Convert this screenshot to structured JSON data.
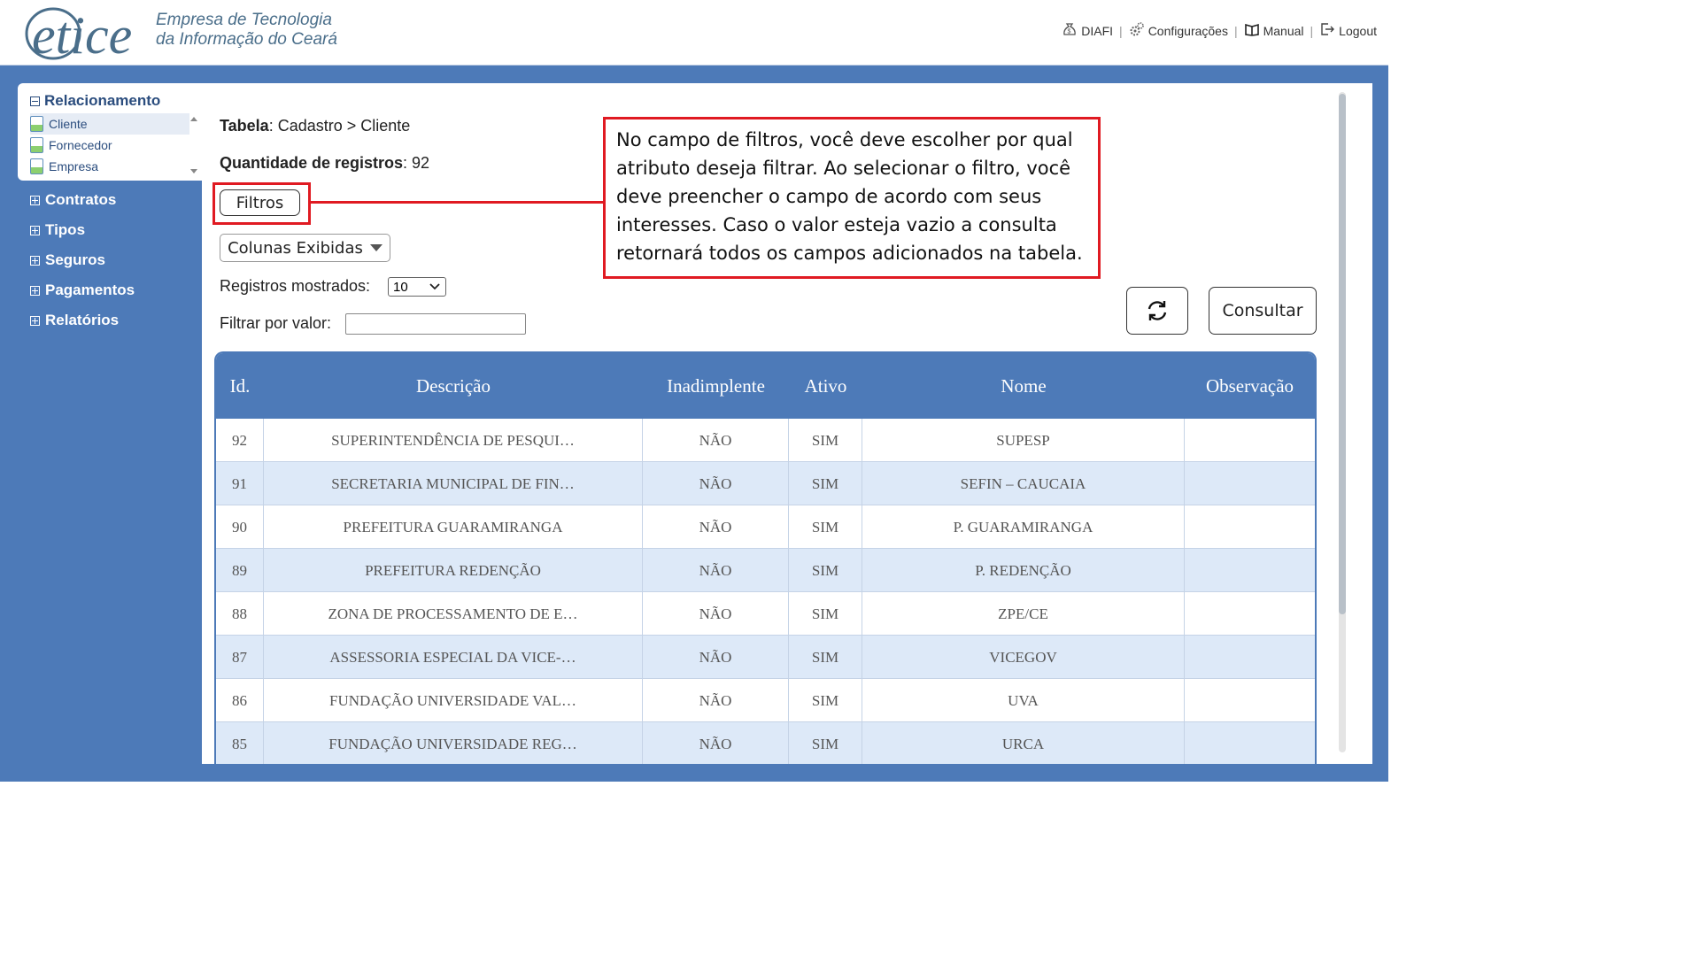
{
  "header": {
    "logo_name": "etice",
    "logo_line1": "Empresa de Tecnologia",
    "logo_line2": "da Informação do Ceará",
    "links": {
      "diafi": "DIAFI",
      "config": "Configurações",
      "manual": "Manual",
      "logout": "Logout",
      "separator": "|"
    }
  },
  "sidebar": {
    "open_group": {
      "title": "Relacionamento",
      "items": [
        "Cliente",
        "Fornecedor",
        "Empresa"
      ],
      "selected": "Cliente"
    },
    "groups": [
      "Contratos",
      "Tipos",
      "Seguros",
      "Pagamentos",
      "Relatórios"
    ]
  },
  "content": {
    "tabela_label": "Tabela",
    "tabela_value": ": Cadastro > Cliente",
    "qtd_label": "Quantidade de registros",
    "qtd_value": ": 92",
    "filtros_button": "Filtros",
    "colunas_button": "Colunas Exibidas",
    "registros_label": "Registros mostrados:",
    "registros_value": "10",
    "filtrar_label": "Filtrar por valor:",
    "filtrar_value": "",
    "consultar_button": "Consultar",
    "refresh_icon": "refresh-icon"
  },
  "callout": {
    "text": "No campo de filtros, você deve escolher por qual atributo deseja filtrar. Ao selecionar o filtro, você deve preencher o campo de acordo com seus interesses. Caso o valor esteja vazio a consulta retornará todos os campos adicionados na tabela.",
    "color": "#e01a22"
  },
  "table": {
    "headers": [
      "Id.",
      "Descrição",
      "Inadimplente",
      "Ativo",
      "Nome",
      "Observação"
    ],
    "rows": [
      [
        "92",
        "SUPERINTENDÊNCIA DE PESQUI…",
        "NÃO",
        "SIM",
        "SUPESP",
        ""
      ],
      [
        "91",
        "SECRETARIA MUNICIPAL DE FIN…",
        "NÃO",
        "SIM",
        "SEFIN – CAUCAIA",
        ""
      ],
      [
        "90",
        "PREFEITURA GUARAMIRANGA",
        "NÃO",
        "SIM",
        "P. GUARAMIRANGA",
        ""
      ],
      [
        "89",
        "PREFEITURA REDENÇÃO",
        "NÃO",
        "SIM",
        "P. REDENÇÃO",
        ""
      ],
      [
        "88",
        "ZONA DE PROCESSAMENTO DE E…",
        "NÃO",
        "SIM",
        "ZPE/CE",
        ""
      ],
      [
        "87",
        "ASSESSORIA ESPECIAL DA VICE-…",
        "NÃO",
        "SIM",
        "VICEGOV",
        ""
      ],
      [
        "86",
        "FUNDAÇÃO UNIVERSIDADE VAL…",
        "NÃO",
        "SIM",
        "UVA",
        ""
      ],
      [
        "85",
        "FUNDAÇÃO UNIVERSIDADE REG…",
        "NÃO",
        "SIM",
        "URCA",
        ""
      ]
    ]
  },
  "colors": {
    "frame_blue": "#4d7ab8",
    "row_alt": "#dde9f8",
    "sidebar_title": "#2b4d7e"
  }
}
